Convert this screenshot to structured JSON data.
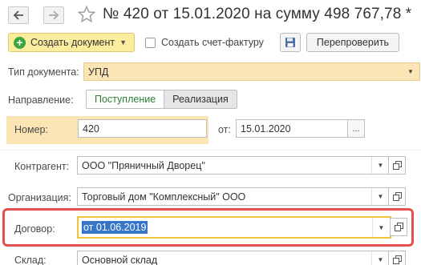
{
  "header": {
    "back_icon": "arrow-left-icon",
    "forward_icon": "arrow-right-icon",
    "favorite_icon": "star-icon",
    "title": "№ 420 от 15.01.2020 на сумму 498 767,78 *"
  },
  "toolbar": {
    "create_document_label": "Создать документ",
    "create_invoice_label": "Создать счет-фактуру",
    "create_invoice_checked": false,
    "save_icon": "floppy-disk-icon",
    "recheck_label": "Перепроверить"
  },
  "form": {
    "doc_type": {
      "label": "Тип документа:",
      "value": "УПД"
    },
    "direction": {
      "label": "Направление:",
      "options": [
        "Поступление",
        "Реализация"
      ],
      "selected": "Поступление"
    },
    "number": {
      "label": "Номер:",
      "value": "420"
    },
    "date": {
      "label": "от:",
      "value": "15.01.2020",
      "picker_label": "..."
    },
    "counterparty": {
      "label": "Контрагент:",
      "value": "ООО \"Пряничный Дворец\""
    },
    "organization": {
      "label": "Организация:",
      "value": "Торговый дом \"Комплексный\" ООО"
    },
    "contract": {
      "label": "Договор:",
      "value": "от 01.06.2019"
    },
    "warehouse": {
      "label": "Склад:",
      "value": "Основной склад"
    }
  },
  "colors": {
    "accent_yellow": "#fbed9e",
    "highlight_red": "#e2504f",
    "selection_blue": "#3576c9",
    "required_field_bg": "#fbe5b5",
    "active_option_green": "#2f7d32"
  }
}
